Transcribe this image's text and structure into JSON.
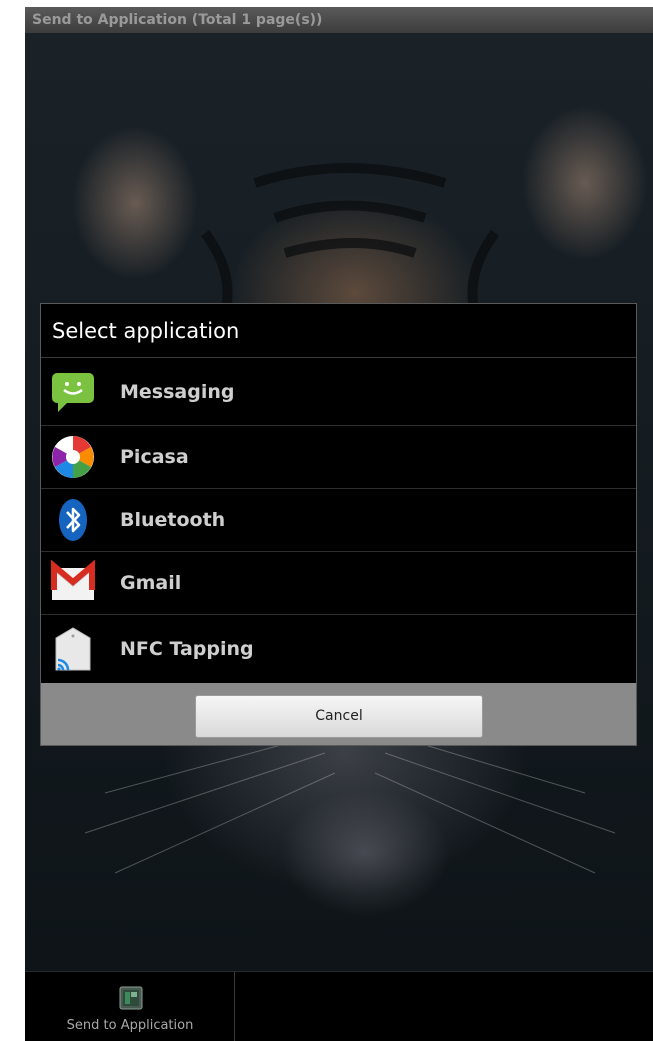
{
  "window": {
    "title": "Send to Application (Total 1 page(s))"
  },
  "dialog": {
    "title": "Select application",
    "apps": [
      {
        "label": "Messaging",
        "icon": "messaging-icon"
      },
      {
        "label": "Picasa",
        "icon": "picasa-icon"
      },
      {
        "label": "Bluetooth",
        "icon": "bluetooth-icon"
      },
      {
        "label": "Gmail",
        "icon": "gmail-icon"
      },
      {
        "label": "NFC Tapping",
        "icon": "nfc-tapping-icon"
      }
    ],
    "cancel_label": "Cancel"
  },
  "bottom_bar": {
    "send_label": "Send to Application",
    "send_icon": "send-to-application-icon"
  },
  "colors": {
    "dialog_background": "#000000",
    "button_bar": "#8a8a8a",
    "title_bar": "#4a4a4a"
  }
}
